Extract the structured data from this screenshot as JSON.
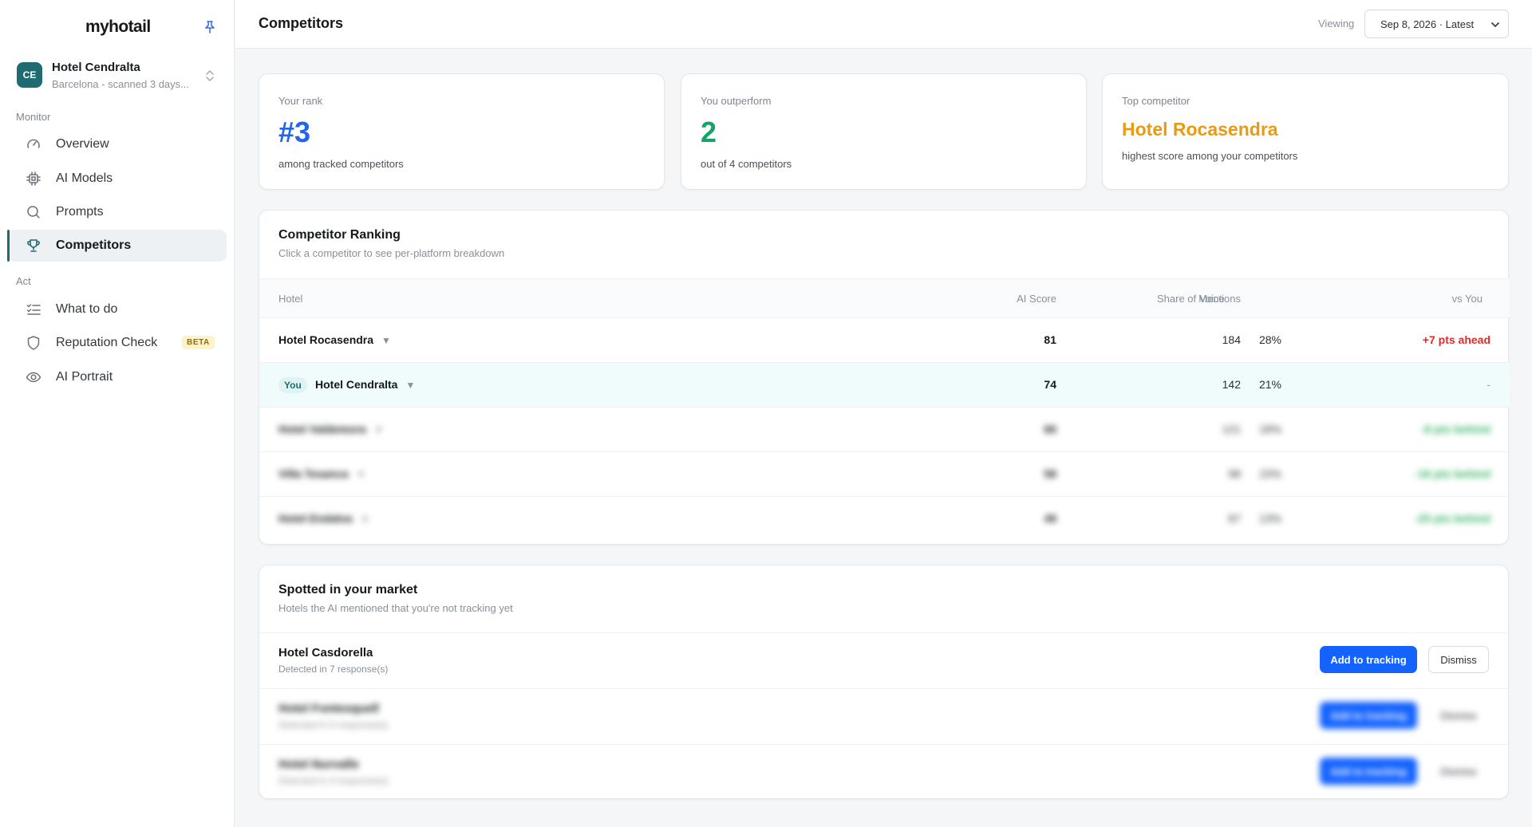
{
  "app": {
    "logo_text": "myhotail"
  },
  "hotel_switcher": {
    "initials": "CE",
    "name": "Hotel Cendralta",
    "subtitle": "Barcelona - scanned 3 days..."
  },
  "sidebar": {
    "monitor_label": "Monitor",
    "act_label": "Act",
    "monitor_items": [
      {
        "label": "Overview",
        "icon": "gauge-icon"
      },
      {
        "label": "AI Models",
        "icon": "chip-icon"
      },
      {
        "label": "Prompts",
        "icon": "search-icon"
      },
      {
        "label": "Competitors",
        "icon": "trophy-icon",
        "active": true
      }
    ],
    "act_items": [
      {
        "label": "What to do",
        "icon": "checklist-icon"
      },
      {
        "label": "Reputation Check",
        "icon": "shield-icon",
        "badge": "BETA"
      },
      {
        "label": "AI Portrait",
        "icon": "eye-icon"
      }
    ]
  },
  "header": {
    "title": "Competitors",
    "viewing_label": "Viewing",
    "date_value": "Sep 8, 2026 · Latest"
  },
  "stats": [
    {
      "label": "Your rank",
      "value": "#3",
      "sub": "among tracked competitors",
      "color": "#2563eb"
    },
    {
      "label": "You outperform",
      "value": "2",
      "sub": "out of 4 competitors",
      "color": "#16a36a"
    },
    {
      "label": "Top competitor",
      "value": "Hotel Rocasendra",
      "sub": "highest score among your competitors",
      "color": "#e89b12"
    }
  ],
  "ranking": {
    "title": "Competitor Ranking",
    "subtitle": "Click a competitor to see per-platform breakdown",
    "columns": [
      "Hotel",
      "AI Score",
      "Mentions",
      "Share of Voice",
      "vs You"
    ],
    "you_badge": "You",
    "rows": [
      {
        "hotel": "Hotel Rocasendra",
        "score": "81",
        "mentions": "184",
        "share": "28%",
        "vs": "+7 pts ahead"
      },
      {
        "hotel": "Hotel Cendralta",
        "score": "74",
        "mentions": "142",
        "share": "21%",
        "vs": "-",
        "is_you": true
      },
      {
        "hotel": "Hotel Valdemora",
        "score": "66",
        "mentions": "121",
        "share": "18%",
        "vs": "-8 pts behind"
      },
      {
        "hotel": "Villa Tesanca",
        "score": "58",
        "mentions": "98",
        "share": "15%",
        "vs": "-16 pts behind"
      },
      {
        "hotel": "Hotel Endalva",
        "score": "49",
        "mentions": "87",
        "share": "13%",
        "vs": "-25 pts behind"
      }
    ]
  },
  "market": {
    "title": "Spotted in your market",
    "subtitle": "Hotels the AI mentioned that you're not tracking yet",
    "add_label": "Add to tracking",
    "dismiss_label": "Dismiss",
    "items": [
      {
        "name": "Hotel Casdorella",
        "detail": "Detected in 7 response(s)"
      },
      {
        "name": "Hotel Fontesquell",
        "detail": "Detected in 5 response(s)"
      },
      {
        "name": "Hotel Nurvalle",
        "detail": "Detected in 4 response(s)"
      }
    ]
  },
  "colors": {
    "accent_teal": "#1f6b72",
    "primary_button": "#1463ff",
    "ahead_red": "#e02b2b",
    "behind_green": "#2fb35f"
  }
}
